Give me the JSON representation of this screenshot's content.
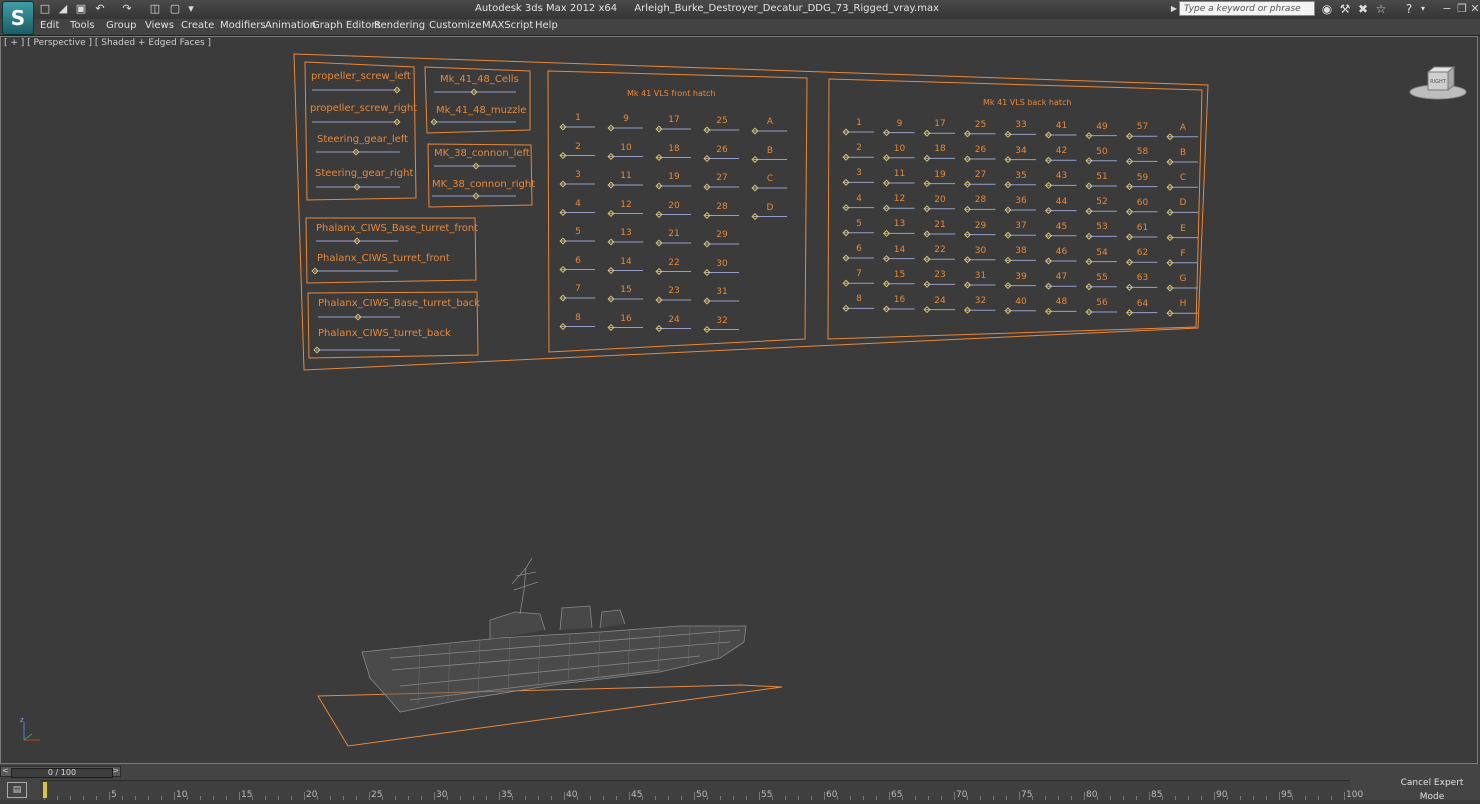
{
  "titlebar": {
    "app_title": "Autodesk 3ds Max  2012 x64",
    "file_name": "Arleigh_Burke_Destroyer_Decatur_DDG_73_Rigged_vray.max",
    "search_placeholder": "Type a keyword or phrase"
  },
  "menu": [
    "Edit",
    "Tools",
    "Group",
    "Views",
    "Create",
    "Modifiers",
    "Animation",
    "Graph Editors",
    "Rendering",
    "Customize",
    "MAXScript",
    "Help"
  ],
  "viewport": {
    "label": "[ + ] [ Perspective ] [ Shaded + Edged Faces ]",
    "viewcube_face": "RIGHT"
  },
  "panels": {
    "left_top": [
      "propeller_screw_left",
      "propeller_screw_right",
      "Steering_gear_left",
      "Steering_gear_right"
    ],
    "mk41_small": [
      "Mk_41_48_Cells",
      "Mk_41_48_muzzle"
    ],
    "mk38": [
      "MK_38_connon_left",
      "MK_38_connon_right"
    ],
    "phalanx_front": [
      "Phalanx_CIWS_Base_turret_front",
      "Phalanx_CIWS_turret_front"
    ],
    "phalanx_back": [
      "Phalanx_CIWS_Base_turret_back",
      "Phalanx_CIWS_turret_back"
    ],
    "front_hatch_title": "Mk 41 VLS front hatch",
    "front_hatch_cols": [
      [
        "1",
        "2",
        "3",
        "4",
        "5",
        "6",
        "7",
        "8"
      ],
      [
        "9",
        "10",
        "11",
        "12",
        "13",
        "14",
        "15",
        "16"
      ],
      [
        "17",
        "18",
        "19",
        "20",
        "21",
        "22",
        "23",
        "24"
      ],
      [
        "25",
        "26",
        "27",
        "28",
        "29",
        "30",
        "31",
        "32"
      ],
      [
        "A",
        "B",
        "C",
        "D"
      ]
    ],
    "back_hatch_title": "Mk 41 VLS back hatch",
    "back_hatch_cols": [
      [
        "1",
        "2",
        "3",
        "4",
        "5",
        "6",
        "7",
        "8"
      ],
      [
        "9",
        "10",
        "11",
        "12",
        "13",
        "14",
        "15",
        "16"
      ],
      [
        "17",
        "18",
        "19",
        "20",
        "21",
        "22",
        "23",
        "24"
      ],
      [
        "25",
        "26",
        "27",
        "28",
        "29",
        "30",
        "31",
        "32"
      ],
      [
        "33",
        "34",
        "35",
        "36",
        "37",
        "38",
        "39",
        "40"
      ],
      [
        "41",
        "42",
        "43",
        "44",
        "45",
        "46",
        "47",
        "48"
      ],
      [
        "49",
        "50",
        "51",
        "52",
        "53",
        "54",
        "55",
        "56"
      ],
      [
        "57",
        "58",
        "59",
        "60",
        "61",
        "62",
        "63",
        "64"
      ],
      [
        "A",
        "B",
        "C",
        "D",
        "E",
        "F",
        "G",
        "H"
      ]
    ]
  },
  "timeline": {
    "frame_display": "0 / 100",
    "ruler_ticks": [
      "5",
      "10",
      "15",
      "20",
      "25",
      "30",
      "35",
      "40",
      "45",
      "50",
      "55",
      "60",
      "65",
      "70",
      "75",
      "80",
      "85",
      "90",
      "95",
      "100"
    ],
    "cancel_label": "Cancel Expert Mode"
  },
  "colors": {
    "accent": "#e8883a",
    "background": "#3b3b3b",
    "wire": "#8a8a8a"
  }
}
